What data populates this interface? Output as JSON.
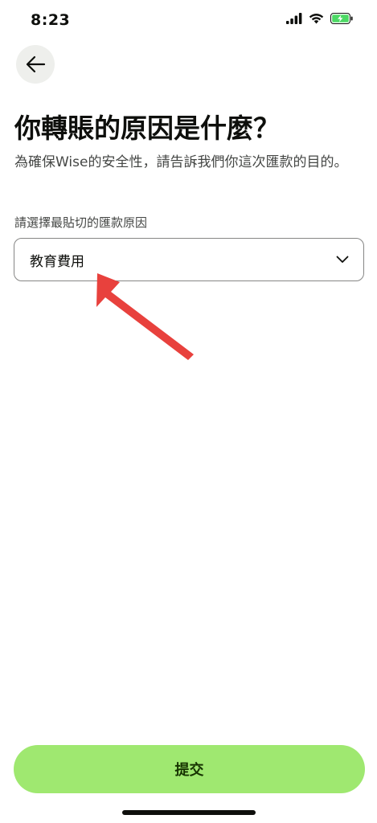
{
  "status_bar": {
    "time": "8:23",
    "icons": [
      "cellular-signal-icon",
      "wifi-icon",
      "battery-charging-icon"
    ],
    "battery_color": "#4cd964"
  },
  "nav": {
    "back_icon": "arrow-left-icon"
  },
  "page": {
    "title": "你轉賬的原因是什麼？",
    "subtitle": "為確保Wise的安全性，請告訴我們你這次匯款的目的。"
  },
  "reason_select": {
    "label": "請選擇最貼切的匯款原因",
    "value": "教育費用",
    "icon": "chevron-down-icon"
  },
  "annotation": {
    "icon": "red-arrow-icon",
    "color": "#e8413d"
  },
  "footer": {
    "submit_label": "提交",
    "submit_color": "#9fe870"
  }
}
